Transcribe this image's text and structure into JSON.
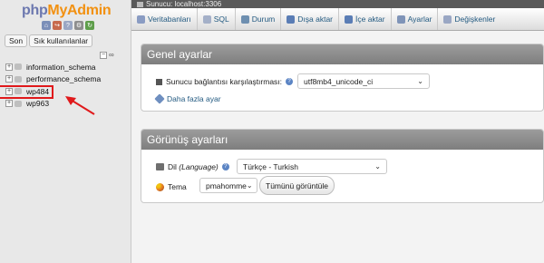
{
  "brand": {
    "php": "php",
    "myadmin": "MyAdmin"
  },
  "nav": {
    "icons": [
      "home-icon",
      "exit-icon",
      "docs-icon",
      "settings-icon",
      "reload-icon"
    ],
    "tabs": [
      {
        "label": "Son"
      },
      {
        "label": "Sık kullanılanlar"
      }
    ],
    "databases": [
      {
        "name": "information_schema"
      },
      {
        "name": "performance_schema"
      },
      {
        "name": "wp484"
      },
      {
        "name": "wp963"
      }
    ],
    "highlight_color": "#e0191b"
  },
  "topbar": {
    "server_label": "Sunucu: localhost:3306"
  },
  "menu": [
    {
      "label": "Veritabanları",
      "icon": "databases-icon"
    },
    {
      "label": "SQL",
      "icon": "sql-icon"
    },
    {
      "label": "Durum",
      "icon": "status-icon"
    },
    {
      "label": "Dışa aktar",
      "icon": "export-icon"
    },
    {
      "label": "İçe aktar",
      "icon": "import-icon"
    },
    {
      "label": "Ayarlar",
      "icon": "settings-icon"
    },
    {
      "label": "Değişkenler",
      "icon": "variables-icon"
    }
  ],
  "general": {
    "title": "Genel ayarlar",
    "collation_label": "Sunucu bağlantısı karşılaştırması:",
    "collation_value": "utf8mb4_unicode_ci",
    "more_settings": "Daha fazla ayar"
  },
  "appearance": {
    "title": "Görünüş ayarları",
    "lang_label_prefix": "Dil ",
    "lang_label_italic": "(Language)",
    "lang_value": "Türkçe - Turkish",
    "theme_label": "Tema",
    "theme_value": "pmahomme",
    "view_all": "Tümünü görüntüle"
  },
  "colors": {
    "link": "#235a81",
    "logo_php": "#6c78af",
    "logo_myadmin": "#f29111"
  }
}
